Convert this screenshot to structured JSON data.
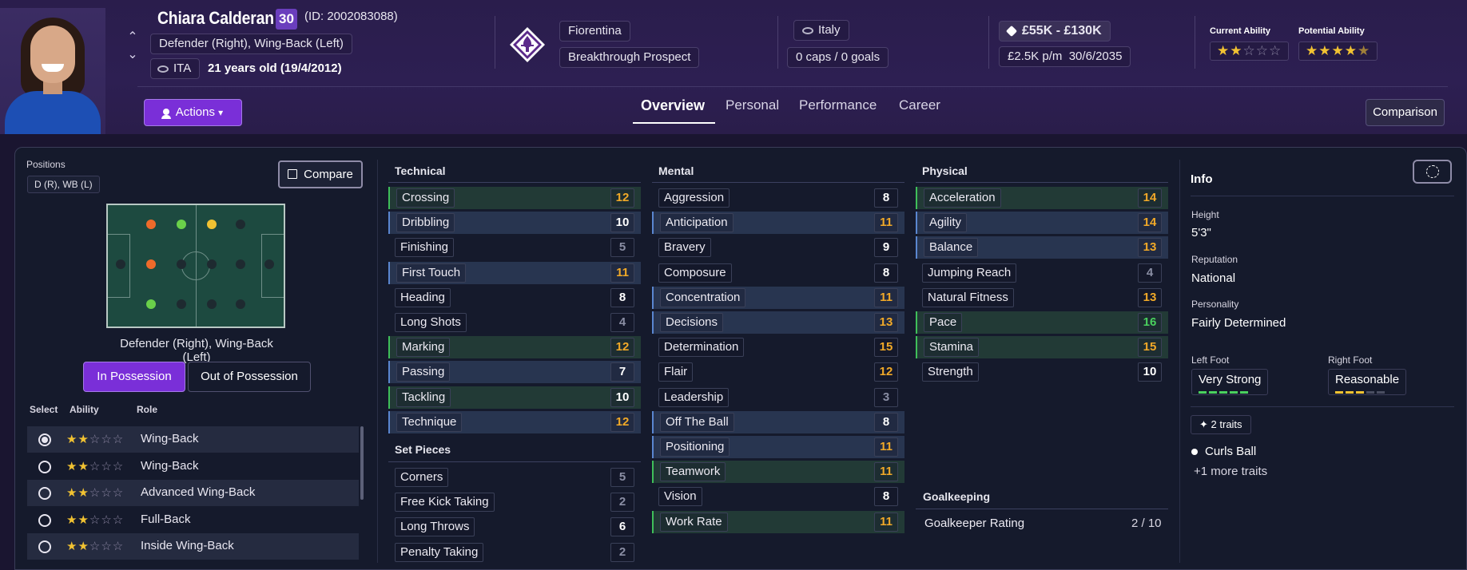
{
  "player": {
    "name": "Chiara Calderan",
    "number": "30",
    "id_text": "(ID: 2002083088)",
    "positions_text": "Defender (Right), Wing-Back (Left)",
    "nationality_code": "ITA",
    "age_text": "21 years old (19/4/2012)"
  },
  "club": {
    "name": "Fiorentina",
    "status": "Breakthrough Prospect"
  },
  "international": {
    "country": "Italy",
    "caps": "0 caps / 0 goals"
  },
  "contract": {
    "value": "£55K - £130K",
    "wage": "£2.5K p/m",
    "expiry": "30/6/2035"
  },
  "ability": {
    "current_label": "Current Ability",
    "potential_label": "Potential Ability",
    "current_stars": 2,
    "potential_stars": 4.5
  },
  "toolbar": {
    "actions_label": "Actions",
    "comparison_label": "Comparison"
  },
  "tabs": [
    {
      "label": "Overview",
      "active": true
    },
    {
      "label": "Personal",
      "active": false
    },
    {
      "label": "Performance",
      "active": false
    },
    {
      "label": "Career",
      "active": false
    }
  ],
  "positions_panel": {
    "label": "Positions",
    "chip": "D (R), WB (L)",
    "compare_label": "Compare",
    "role_text": "Defender (Right), Wing-Back (Left)",
    "in_possession": "In Possession",
    "out_of_possession": "Out of Possession",
    "headers": {
      "select": "Select",
      "ability": "Ability",
      "role": "Role"
    },
    "roles": [
      {
        "name": "Wing-Back",
        "stars": 2,
        "selected": true
      },
      {
        "name": "Wing-Back",
        "stars": 2,
        "selected": false
      },
      {
        "name": "Advanced Wing-Back",
        "stars": 2,
        "selected": false
      },
      {
        "name": "Full-Back",
        "stars": 2,
        "selected": false
      },
      {
        "name": "Inside Wing-Back",
        "stars": 2,
        "selected": false
      }
    ]
  },
  "attributes": {
    "technical_title": "Technical",
    "technical": [
      {
        "name": "Crossing",
        "value": "12"
      },
      {
        "name": "Dribbling",
        "value": "10"
      },
      {
        "name": "Finishing",
        "value": "5"
      },
      {
        "name": "First Touch",
        "value": "11"
      },
      {
        "name": "Heading",
        "value": "8"
      },
      {
        "name": "Long Shots",
        "value": "4"
      },
      {
        "name": "Marking",
        "value": "12"
      },
      {
        "name": "Passing",
        "value": "7"
      },
      {
        "name": "Tackling",
        "value": "10"
      },
      {
        "name": "Technique",
        "value": "12"
      }
    ],
    "set_pieces_title": "Set Pieces",
    "set_pieces": [
      {
        "name": "Corners",
        "value": "5"
      },
      {
        "name": "Free Kick Taking",
        "value": "2"
      },
      {
        "name": "Long Throws",
        "value": "6"
      },
      {
        "name": "Penalty Taking",
        "value": "2"
      }
    ],
    "mental_title": "Mental",
    "mental": [
      {
        "name": "Aggression",
        "value": "8"
      },
      {
        "name": "Anticipation",
        "value": "11"
      },
      {
        "name": "Bravery",
        "value": "9"
      },
      {
        "name": "Composure",
        "value": "8"
      },
      {
        "name": "Concentration",
        "value": "11"
      },
      {
        "name": "Decisions",
        "value": "13"
      },
      {
        "name": "Determination",
        "value": "15"
      },
      {
        "name": "Flair",
        "value": "12"
      },
      {
        "name": "Leadership",
        "value": "3"
      },
      {
        "name": "Off The Ball",
        "value": "8"
      },
      {
        "name": "Positioning",
        "value": "11"
      },
      {
        "name": "Teamwork",
        "value": "11"
      },
      {
        "name": "Vision",
        "value": "8"
      },
      {
        "name": "Work Rate",
        "value": "11"
      }
    ],
    "physical_title": "Physical",
    "physical": [
      {
        "name": "Acceleration",
        "value": "14"
      },
      {
        "name": "Agility",
        "value": "14"
      },
      {
        "name": "Balance",
        "value": "13"
      },
      {
        "name": "Jumping Reach",
        "value": "4"
      },
      {
        "name": "Natural Fitness",
        "value": "13"
      },
      {
        "name": "Pace",
        "value": "16"
      },
      {
        "name": "Stamina",
        "value": "15"
      },
      {
        "name": "Strength",
        "value": "10"
      }
    ],
    "goalkeeping_title": "Goalkeeping",
    "goalkeeper_rating_label": "Goalkeeper Rating",
    "goalkeeper_rating_value": "2 / 10"
  },
  "info": {
    "title": "Info",
    "height_label": "Height",
    "height": "5'3\"",
    "reputation_label": "Reputation",
    "reputation": "National",
    "personality_label": "Personality",
    "personality": "Fairly Determined",
    "left_foot_label": "Left Foot",
    "left_foot": "Very Strong",
    "left_foot_level": 5,
    "right_foot_label": "Right Foot",
    "right_foot": "Reasonable",
    "right_foot_level": 3,
    "traits_chip": "2 traits",
    "trait_1": "Curls Ball",
    "more_traits": "+1 more traits"
  },
  "colors": {
    "accent_purple": "#7a2fd8",
    "attr_gold": "#f1a928",
    "attr_green": "#4ad15e",
    "star_gold": "#f1c232"
  }
}
